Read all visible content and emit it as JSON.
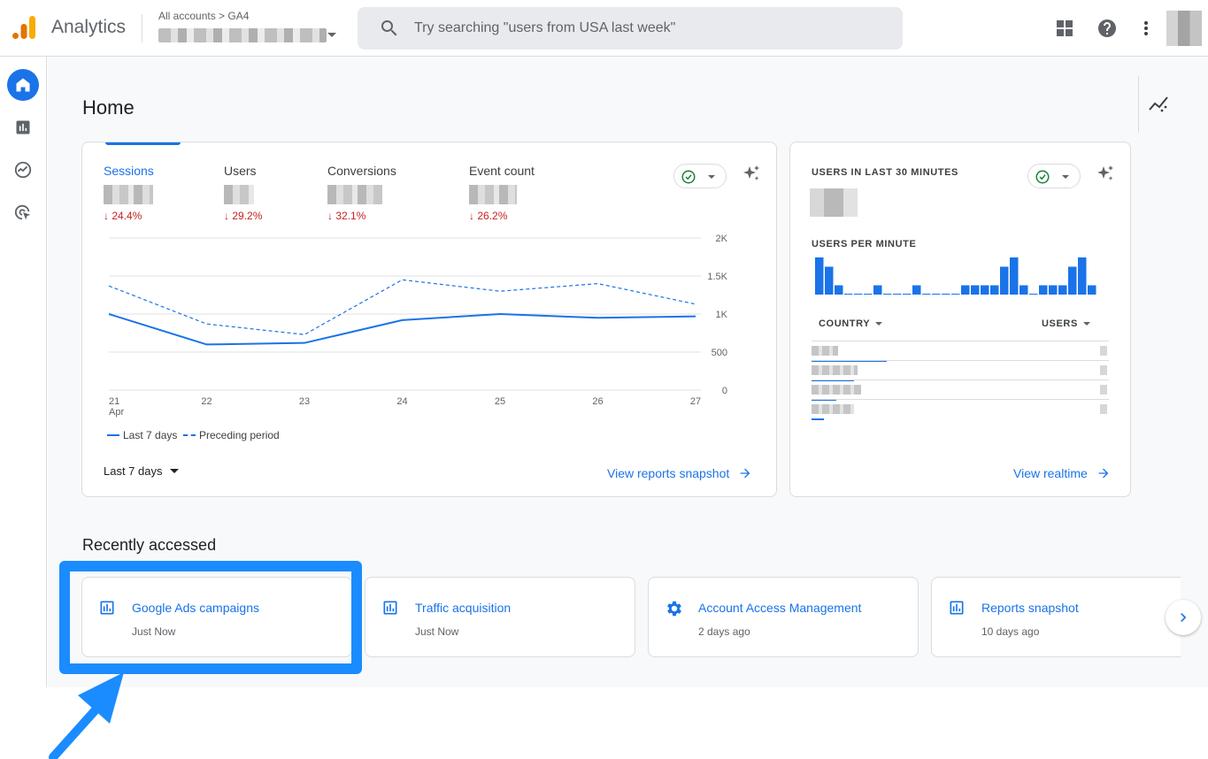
{
  "header": {
    "app_name": "Analytics",
    "breadcrumb": "All accounts > GA4",
    "search_placeholder": "Try searching \"users from USA last week\""
  },
  "colors": {
    "accent": "#1a73e8",
    "negative": "#c5221f",
    "highlight": "#1a8cff"
  },
  "page": {
    "title": "Home"
  },
  "overview": {
    "metrics": [
      {
        "label": "Sessions",
        "change": "24.4%"
      },
      {
        "label": "Users",
        "change": "29.2%"
      },
      {
        "label": "Conversions",
        "change": "32.1%"
      },
      {
        "label": "Event count",
        "change": "26.2%"
      }
    ],
    "range_label": "Last 7 days",
    "link_label": "View reports snapshot"
  },
  "chart_data": {
    "type": "line",
    "x": [
      "21",
      "22",
      "23",
      "24",
      "25",
      "26",
      "27"
    ],
    "x_sub": "Apr",
    "yticks": [
      "2K",
      "1.5K",
      "1K",
      "500",
      "0"
    ],
    "ylim": [
      0,
      2000
    ],
    "grid": true,
    "legend_position": "bottom-left",
    "series": [
      {
        "name": "Last 7 days",
        "style": "solid",
        "values": [
          1000,
          600,
          620,
          920,
          1000,
          950,
          970
        ]
      },
      {
        "name": "Preceding period",
        "style": "dashed",
        "values": [
          1370,
          870,
          730,
          1450,
          1300,
          1400,
          1130
        ]
      }
    ]
  },
  "realtime": {
    "title": "USERS IN LAST 30 MINUTES",
    "per_minute_label": "USERS PER MINUTE",
    "per_minute": [
      4,
      3,
      1,
      0,
      0,
      0,
      1,
      0,
      0,
      0,
      1,
      0,
      0,
      0,
      0,
      1,
      1,
      1,
      1,
      3,
      4,
      1,
      0,
      1,
      1,
      1,
      3,
      4,
      1
    ],
    "col_country": "COUNTRY",
    "col_users": "USERS",
    "rows": [
      {
        "share": 0.92
      },
      {
        "share": 0.52
      },
      {
        "share": 0.3
      },
      {
        "share": 0.15
      }
    ],
    "link_label": "View realtime"
  },
  "recent": {
    "title": "Recently accessed",
    "items": [
      {
        "title": "Google Ads campaigns",
        "time": "Just Now",
        "icon": "bar-chart-icon"
      },
      {
        "title": "Traffic acquisition",
        "time": "Just Now",
        "icon": "bar-chart-icon"
      },
      {
        "title": "Account Access Management",
        "time": "2 days ago",
        "icon": "gear-icon"
      },
      {
        "title": "Reports snapshot",
        "time": "10 days ago",
        "icon": "bar-chart-icon"
      }
    ]
  }
}
